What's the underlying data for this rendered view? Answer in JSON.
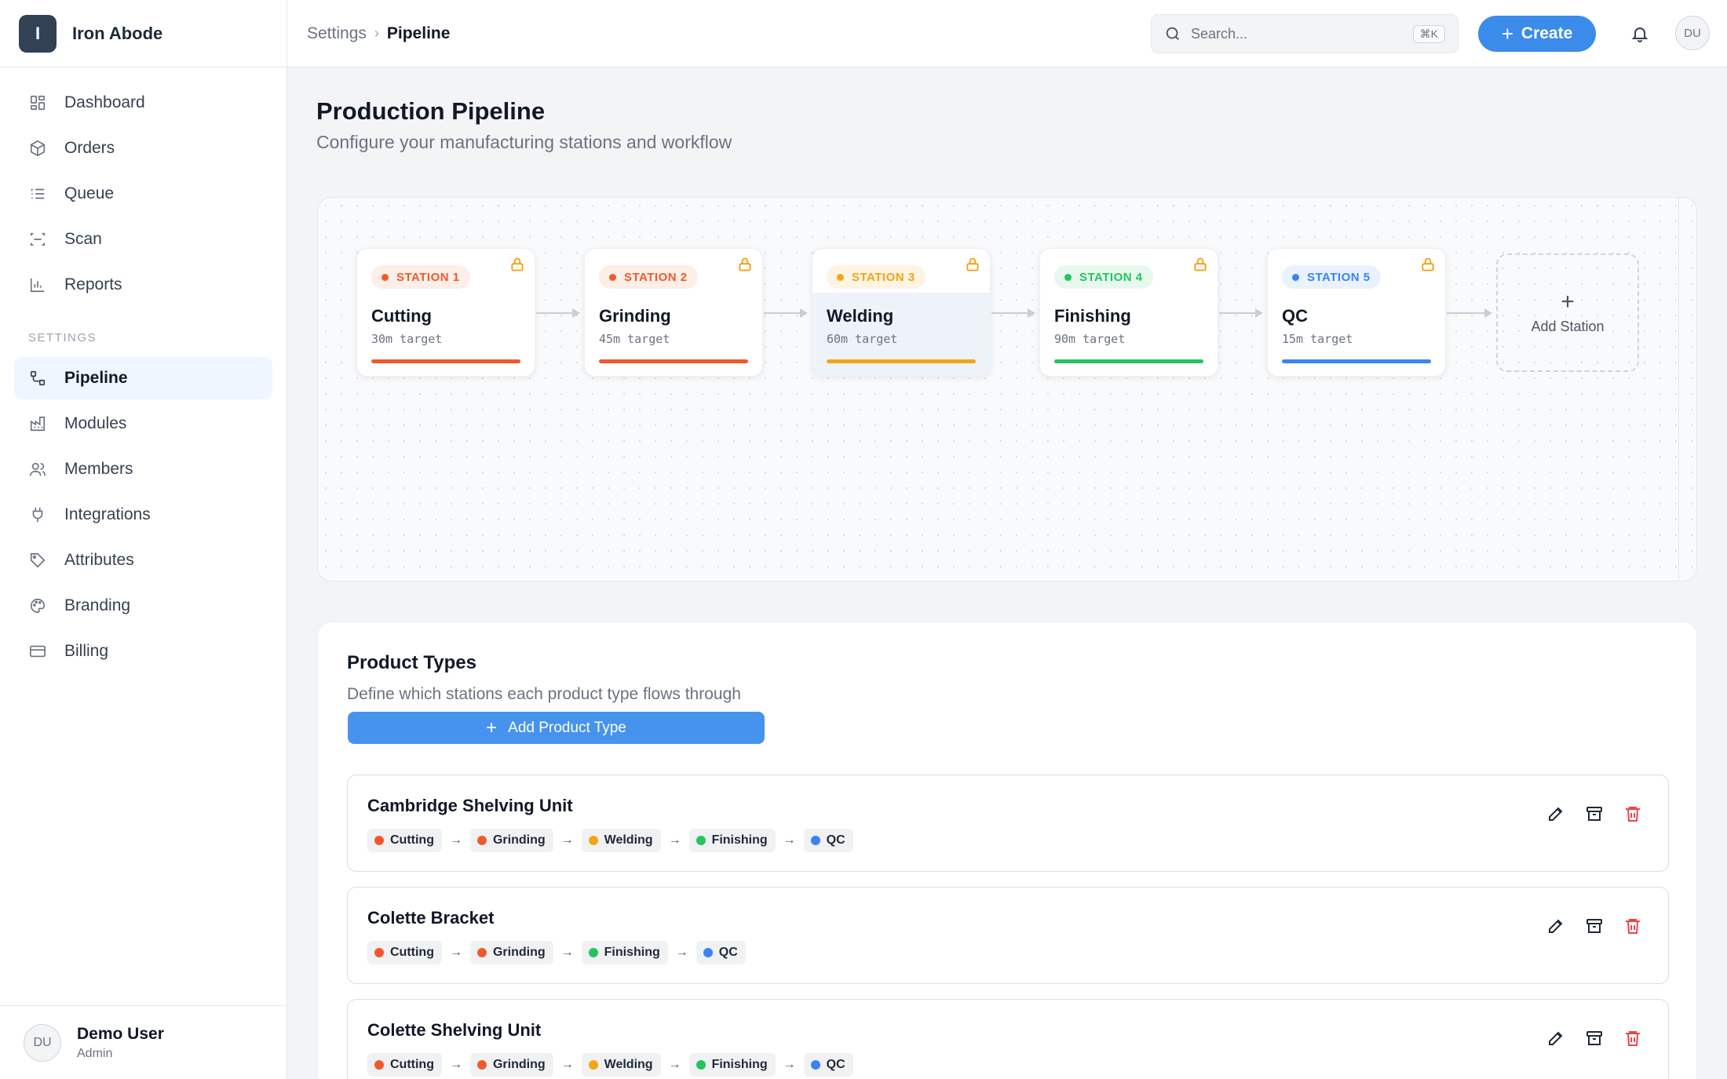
{
  "app": {
    "name": "Iron Abode",
    "logo_letter": "I"
  },
  "sidebar": {
    "items": [
      {
        "label": "Dashboard",
        "icon": "dashboard-icon"
      },
      {
        "label": "Orders",
        "icon": "box-icon"
      },
      {
        "label": "Queue",
        "icon": "list-icon"
      },
      {
        "label": "Scan",
        "icon": "scan-icon"
      },
      {
        "label": "Reports",
        "icon": "bar-chart-icon"
      }
    ],
    "section_label": "SETTINGS",
    "settings_items": [
      {
        "label": "Pipeline",
        "icon": "pipeline-icon",
        "active": true
      },
      {
        "label": "Modules",
        "icon": "factory-icon"
      },
      {
        "label": "Members",
        "icon": "users-icon"
      },
      {
        "label": "Integrations",
        "icon": "plug-icon"
      },
      {
        "label": "Attributes",
        "icon": "tag-icon"
      },
      {
        "label": "Branding",
        "icon": "palette-icon"
      },
      {
        "label": "Billing",
        "icon": "credit-card-icon"
      }
    ],
    "user": {
      "initials": "DU",
      "name": "Demo User",
      "role": "Admin"
    }
  },
  "topbar": {
    "breadcrumb": [
      "Settings",
      "Pipeline"
    ],
    "search_placeholder": "Search...",
    "search_shortcut": "⌘K",
    "create_label": "Create",
    "avatar_initials": "DU"
  },
  "page": {
    "title": "Production Pipeline",
    "subtitle": "Configure your manufacturing stations and workflow"
  },
  "stations": [
    {
      "badge": "STATION 1",
      "name": "Cutting",
      "target": "30m target",
      "color": "#f05a2b",
      "badge_bg": "#fdeee8"
    },
    {
      "badge": "STATION 2",
      "name": "Grinding",
      "target": "45m target",
      "color": "#f05a2b",
      "badge_bg": "#fdeee8"
    },
    {
      "badge": "STATION 3",
      "name": "Welding",
      "target": "60m target",
      "color": "#f2a516",
      "badge_bg": "#fdf4e3",
      "selected": true
    },
    {
      "badge": "STATION 4",
      "name": "Finishing",
      "target": "90m target",
      "color": "#22c55e",
      "badge_bg": "#e8f8ee"
    },
    {
      "badge": "STATION 5",
      "name": "QC",
      "target": "15m target",
      "color": "#3b82f6",
      "badge_bg": "#eaf2fe"
    }
  ],
  "add_station_label": "Add Station",
  "product_types": {
    "title": "Product Types",
    "subtitle": "Define which stations each product type flows through",
    "add_label": "Add Product Type",
    "rows": [
      {
        "name": "Cambridge Shelving Unit",
        "stations": [
          "Cutting",
          "Grinding",
          "Welding",
          "Finishing",
          "QC"
        ]
      },
      {
        "name": "Colette Bracket",
        "stations": [
          "Cutting",
          "Grinding",
          "Finishing",
          "QC"
        ]
      },
      {
        "name": "Colette Shelving Unit",
        "stations": [
          "Cutting",
          "Grinding",
          "Welding",
          "Finishing",
          "QC"
        ]
      }
    ]
  },
  "station_colors": {
    "Cutting": "#f05a2b",
    "Grinding": "#f05a2b",
    "Welding": "#f2a516",
    "Finishing": "#22c55e",
    "QC": "#3b82f6"
  }
}
